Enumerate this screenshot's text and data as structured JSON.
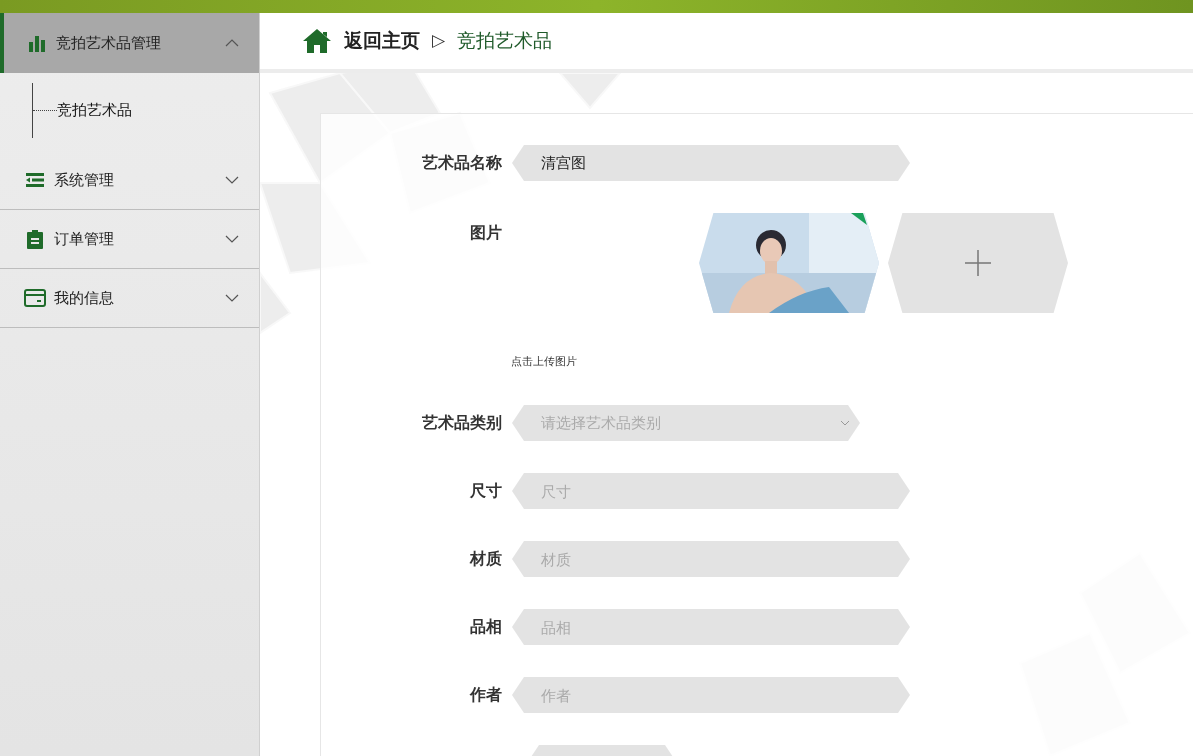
{
  "sidebar": {
    "items": [
      {
        "label": "竞拍艺术品管理",
        "selected": true,
        "expanded": true,
        "children": [
          {
            "label": "竞拍艺术品"
          }
        ]
      },
      {
        "label": "系统管理",
        "selected": false,
        "expanded": false
      },
      {
        "label": "订单管理",
        "selected": false,
        "expanded": false
      },
      {
        "label": "我的信息",
        "selected": false,
        "expanded": false
      }
    ]
  },
  "breadcrumb": {
    "home": "返回主页",
    "separator": "▷",
    "current": "竞拍艺术品"
  },
  "form": {
    "fields": [
      {
        "kind": "text",
        "label": "艺术品名称",
        "value": "清宫图"
      },
      {
        "label": "图片",
        "hint": "点击上传图片",
        "uploaded": true
      },
      {
        "kind": "select",
        "label": "艺术品类别",
        "placeholder": "请选择艺术品类别"
      },
      {
        "kind": "text",
        "label": "尺寸",
        "placeholder": "尺寸"
      },
      {
        "kind": "text",
        "label": "材质",
        "placeholder": "材质"
      },
      {
        "kind": "text",
        "label": "品相",
        "placeholder": "品相"
      },
      {
        "kind": "text",
        "label": "作者",
        "placeholder": "作者"
      },
      {
        "kind": "partial"
      }
    ]
  }
}
